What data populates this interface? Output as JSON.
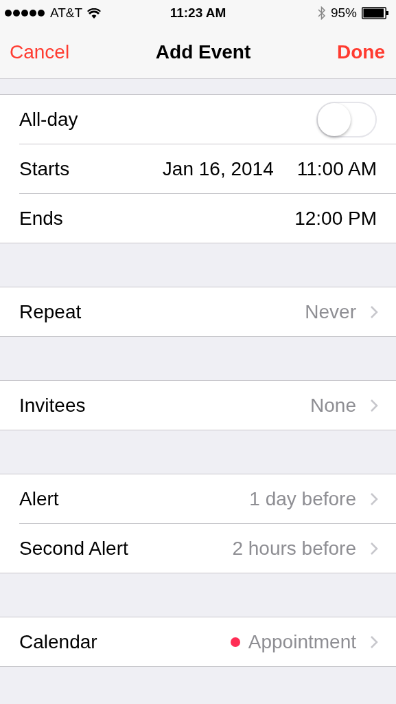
{
  "status_bar": {
    "carrier": "AT&T",
    "time": "11:23 AM",
    "battery": "95%",
    "bluetooth": true
  },
  "nav": {
    "cancel": "Cancel",
    "title": "Add Event",
    "done": "Done"
  },
  "sections": [
    {
      "rows": [
        {
          "kind": "toggle",
          "label": "All-day",
          "on": false
        },
        {
          "kind": "datetime",
          "label": "Starts",
          "date": "Jan 16, 2014",
          "time": "11:00 AM"
        },
        {
          "kind": "datetime",
          "label": "Ends",
          "time": "12:00 PM"
        }
      ]
    },
    {
      "rows": [
        {
          "kind": "detail",
          "label": "Repeat",
          "value": "Never"
        }
      ]
    },
    {
      "rows": [
        {
          "kind": "detail",
          "label": "Invitees",
          "value": "None"
        }
      ]
    },
    {
      "rows": [
        {
          "kind": "detail",
          "label": "Alert",
          "value": "1 day before"
        },
        {
          "kind": "detail",
          "label": "Second Alert",
          "value": "2 hours before"
        }
      ]
    },
    {
      "rows": [
        {
          "kind": "detail",
          "label": "Calendar",
          "value": "Appointment",
          "color": "#ff2d55"
        }
      ]
    }
  ]
}
